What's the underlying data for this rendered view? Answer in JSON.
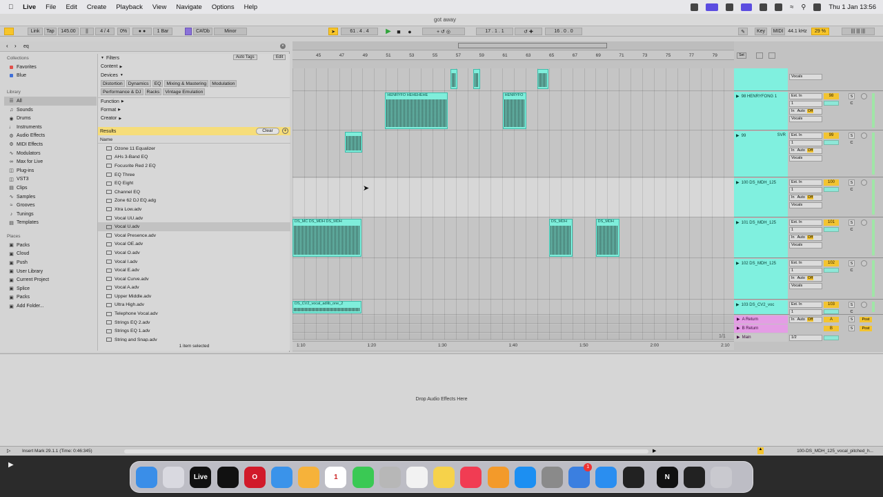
{
  "menubar": {
    "items": [
      "Live",
      "File",
      "Edit",
      "Create",
      "Playback",
      "View",
      "Navigate",
      "Options",
      "Help"
    ],
    "window_title": "got away",
    "clock": "Thu 1 Jan 13:56"
  },
  "transport": {
    "link": "Link",
    "tap": "Tap",
    "tempo": "145.00",
    "time_sig": "4 / 4",
    "swing": "0%",
    "quantize": "1 Bar",
    "key": "C#/Db",
    "scale": "Minor",
    "position": "61 . 4 . 4",
    "loop_start": "17 . 1 . 1",
    "loop_length": "16 . 0 . 0",
    "key_label": "Key",
    "midi_label": "MIDI",
    "sample_rate": "44.1 kHz",
    "cpu": "29 %"
  },
  "browser": {
    "search_value": "eq",
    "collections_title": "Collections",
    "collections": [
      {
        "label": "Favorites",
        "color": "#e0504a"
      },
      {
        "label": "Blue",
        "color": "#3f6fd8"
      }
    ],
    "library_title": "Library",
    "library": [
      {
        "label": "All",
        "icon": "list-icon"
      },
      {
        "label": "Sounds",
        "icon": "sound-icon"
      },
      {
        "label": "Drums",
        "icon": "drum-icon"
      },
      {
        "label": "Instruments",
        "icon": "instrument-icon"
      },
      {
        "label": "Audio Effects",
        "icon": "audio-fx-icon"
      },
      {
        "label": "MIDI Effects",
        "icon": "midi-fx-icon"
      },
      {
        "label": "Modulators",
        "icon": "modulator-icon"
      },
      {
        "label": "Max for Live",
        "icon": "max-icon"
      },
      {
        "label": "Plug-ins",
        "icon": "plugin-icon"
      },
      {
        "label": "VST3",
        "icon": "vst-icon"
      },
      {
        "label": "Clips",
        "icon": "clip-icon"
      },
      {
        "label": "Samples",
        "icon": "sample-icon"
      },
      {
        "label": "Grooves",
        "icon": "groove-icon"
      },
      {
        "label": "Tunings",
        "icon": "tuning-icon"
      },
      {
        "label": "Templates",
        "icon": "template-icon"
      }
    ],
    "places_title": "Places",
    "places": [
      "Packs",
      "Cloud",
      "Push",
      "User Library",
      "Current Project",
      "Splice",
      "Packs",
      "Add Folder..."
    ],
    "filters_label": "Filters",
    "auto_tags": "Auto Tags",
    "edit": "Edit",
    "content": "Content",
    "devices": "Devices",
    "device_tags": [
      "Distortion",
      "Dynamics",
      "EQ",
      "Mixing & Mastering",
      "Modulation",
      "Performance & DJ",
      "Racks",
      "Vintage Emulation"
    ],
    "function": "Function",
    "format": "Format",
    "creator": "Creator",
    "results": "Results",
    "clear": "Clear",
    "name_header": "Name",
    "results_list": [
      "Ozone 11 Equalizer",
      "AHs 3-Band EQ",
      "Focusrite Red 2 EQ",
      "EQ Three",
      "EQ Eight",
      "Channel EQ",
      "Zone 62 DJ EQ.adg",
      "Xtra Low.adv",
      "Vocal UU.adv",
      "Vocal U.adv",
      "Vocal Presence.adv",
      "Vocal OE.adv",
      "Vocal O.adv",
      "Vocal I.adv",
      "Vocal E.adv",
      "Vocal Curve.adv",
      "Vocal A.adv",
      "Upper Middle.adv",
      "Ultra High.adv",
      "Telephone Vocal.adv",
      "Strings EQ 2.adv",
      "Strings EQ 1.adv",
      "String and Snap.adv"
    ],
    "selected_result": 9,
    "footer": "1 item selected"
  },
  "arrangement": {
    "bars": [
      "45",
      "47",
      "49",
      "51",
      "53",
      "55",
      "57",
      "59",
      "61",
      "63",
      "65",
      "67",
      "69",
      "71",
      "73",
      "75",
      "77",
      "79"
    ],
    "times": [
      "1:10",
      "1:20",
      "1:30",
      "1:40",
      "1:50",
      "2:00",
      "2:10"
    ],
    "clips": [
      {
        "lane": 0,
        "name": "",
        "start": 0.358,
        "width": 0.015,
        "dark": true
      },
      {
        "lane": 0,
        "name": "",
        "start": 0.41,
        "width": 0.015,
        "dark": true
      },
      {
        "lane": 0,
        "name": "",
        "start": 0.555,
        "width": 0.025,
        "dark": true
      },
      {
        "lane": 1,
        "name": "HENRYFO HEHEHEHE",
        "start": 0.21,
        "width": 0.142,
        "dark": false
      },
      {
        "lane": 1,
        "name": "HENRYFO",
        "start": 0.476,
        "width": 0.053,
        "dark": false
      },
      {
        "lane": 2,
        "name": "",
        "start": 0.118,
        "width": 0.04,
        "dark": true
      },
      {
        "lane": 4,
        "name": "DS_MC DS_MDH DS_MDH",
        "start": 0.0,
        "width": 0.157,
        "dark": false
      },
      {
        "lane": 4,
        "name": "DS_MDH",
        "start": 0.581,
        "width": 0.053,
        "dark": false
      },
      {
        "lane": 4,
        "name": "DS_MDH",
        "start": 0.687,
        "width": 0.053,
        "dark": false
      },
      {
        "lane": 6,
        "name": "DS_CV2_vocal_adlib_one_2",
        "start": 0.0,
        "width": 0.157,
        "dark": false
      }
    ],
    "page_indicator": "1/1"
  },
  "mixer": {
    "tracks": [
      {
        "name": "",
        "input": "Vocals",
        "vol": "",
        "num": "",
        "color": "#80f0df"
      },
      {
        "name": "98 HENRYFONG 1",
        "input": "Ext. In",
        "vol": "98",
        "num": "98",
        "color": "#80f0df"
      },
      {
        "name": "99",
        "extra": "SVR",
        "input": "Ext. In",
        "vol": "99",
        "num": "99",
        "color": "#80f0df"
      },
      {
        "name": "100 DS_MDH_125",
        "input": "Ext. In",
        "vol": "100",
        "num": "100",
        "color": "#80f0df"
      },
      {
        "name": "101 DS_MDH_125",
        "input": "Ext. In",
        "vol": "101",
        "num": "101",
        "color": "#80f0df"
      },
      {
        "name": "102 DS_MDH_125",
        "input": "Ext. In",
        "vol": "102",
        "num": "102",
        "color": "#80f0df"
      },
      {
        "name": "103 DS_CV2_voc",
        "input": "Ext. In",
        "vol": "103",
        "num": "103",
        "color": "#80f0df"
      }
    ],
    "sub_labels": {
      "channel": "1",
      "auto": "Auto",
      "in": "In",
      "off": "Off",
      "vocals": "Vocals",
      "s": "S",
      "c": "C"
    },
    "returns": [
      {
        "name": "A Return",
        "letter": "A",
        "post": "Post"
      },
      {
        "name": "B Return",
        "letter": "B",
        "post": "Post"
      }
    ],
    "main": {
      "name": "Main",
      "ratio": "1/2"
    }
  },
  "detail": {
    "drop_text": "Drop Audio Effects Here"
  },
  "status": {
    "left": "Insert Mark 29.1.1 (Time: 0:46:345)",
    "right": "100-DS_MDH_125_vocal_pitched_h..."
  },
  "dock": {
    "apps": [
      {
        "name": "finder",
        "label": "",
        "color": "#3a8ee8"
      },
      {
        "name": "launchpad",
        "label": "",
        "color": "#d9d9e0"
      },
      {
        "name": "live",
        "label": "Live",
        "color": "#111111"
      },
      {
        "name": "splice",
        "label": "",
        "color": "#111111"
      },
      {
        "name": "opera",
        "label": "O",
        "color": "#d11a2a"
      },
      {
        "name": "mail",
        "label": "",
        "color": "#3a93ea"
      },
      {
        "name": "photos",
        "label": "",
        "color": "#f6b23a"
      },
      {
        "name": "calendar",
        "label": "1",
        "color": "#ffffff"
      },
      {
        "name": "messages",
        "label": "",
        "color": "#3ac954"
      },
      {
        "name": "contacts",
        "label": "",
        "color": "#b7b7b7"
      },
      {
        "name": "reminders",
        "label": "",
        "color": "#f2f2f2"
      },
      {
        "name": "notes",
        "label": "",
        "color": "#f6d24a"
      },
      {
        "name": "music",
        "label": "",
        "color": "#f13c53"
      },
      {
        "name": "pages",
        "label": "",
        "color": "#f39a2a"
      },
      {
        "name": "app-store",
        "label": "",
        "color": "#1c8ff2"
      },
      {
        "name": "system-settings",
        "label": "",
        "color": "#8a8a8a"
      },
      {
        "name": "preview",
        "label": "",
        "color": "#3b7fe0"
      },
      {
        "name": "safari",
        "label": "",
        "color": "#2a8ef0"
      },
      {
        "name": "logic",
        "label": "",
        "color": "#222222"
      },
      {
        "name": "native-access",
        "label": "N",
        "color": "#111111"
      },
      {
        "name": "app-extra",
        "label": "",
        "color": "#222222"
      },
      {
        "name": "trash",
        "label": "",
        "color": "#c9c9cf"
      }
    ],
    "badge": "1"
  }
}
